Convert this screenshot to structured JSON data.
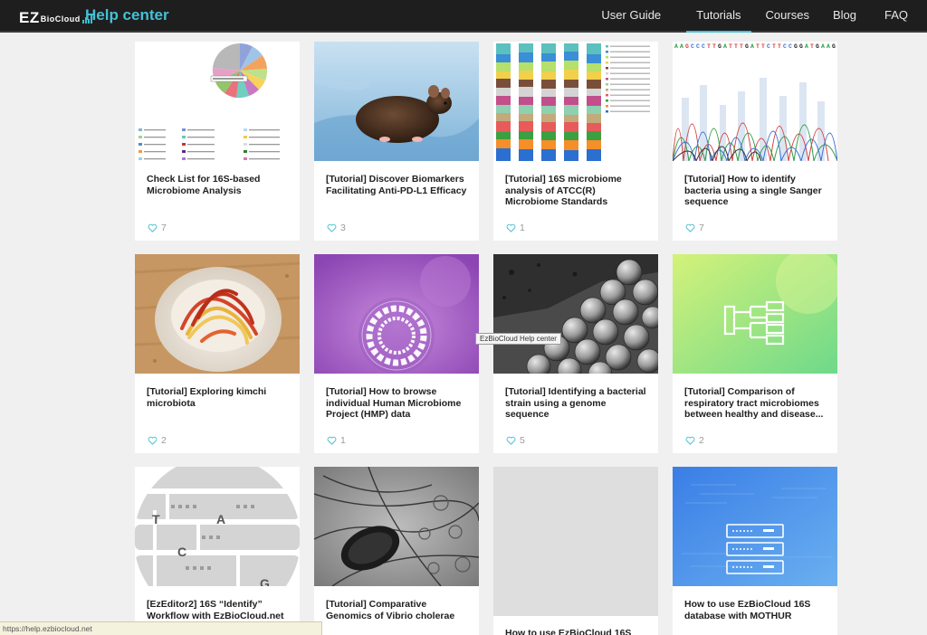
{
  "header": {
    "logo": {
      "main": "EZ",
      "sub": "BioCloud"
    },
    "title": "Help center",
    "nav": [
      {
        "label": "User Guide"
      },
      {
        "label": "Tutorials",
        "active": true
      },
      {
        "label": "Courses"
      },
      {
        "label": "Blog"
      },
      {
        "label": "FAQ"
      }
    ],
    "accent_color": "#44c1d6"
  },
  "cards": [
    {
      "title": "Check List for 16S-based Microbiome Analysis",
      "likes": "7",
      "thumbnail": "pie-chart-legend"
    },
    {
      "title": "[Tutorial] Discover Biomarkers Facilitating Anti-PD-L1 Efficacy",
      "likes": "3",
      "thumbnail": "mouse-photo"
    },
    {
      "title": "[Tutorial] 16S microbiome analysis of ATCC(R) Microbiome Standards",
      "likes": "1",
      "thumbnail": "stacked-bars"
    },
    {
      "title": "[Tutorial] How to identify bacteria using a single Sanger sequence",
      "likes": "7",
      "thumbnail": "chromatogram"
    },
    {
      "title": "[Tutorial] Exploring kimchi microbiota",
      "likes": "2",
      "thumbnail": "kimchi-photo"
    },
    {
      "title": "[Tutorial] How to browse individual Human Microbiome Project (HMP) data",
      "likes": "1",
      "thumbnail": "purple-circle-icon"
    },
    {
      "title": "[Tutorial] Identifying a bacterial strain using a genome sequence",
      "likes": "5",
      "thumbnail": "bacteria-micrograph"
    },
    {
      "title": "[Tutorial] Comparison of respiratory tract microbiomes between healthy and disease...",
      "likes": "2",
      "thumbnail": "green-tree-icon"
    },
    {
      "title": "[EzEditor2] 16S “Identify” Workflow with EzBioCloud.net",
      "likes": "",
      "thumbnail": "sequence-circle",
      "letters": [
        "T",
        "A",
        "C",
        "G"
      ]
    },
    {
      "title": "[Tutorial] Comparative Genomics of Vibrio cholerae",
      "likes": "",
      "thumbnail": "vibrio-micrograph"
    },
    {
      "title": "How to use EzBioCloud 16S",
      "likes": "",
      "thumbnail": "blank"
    },
    {
      "title": "How to use EzBioCloud 16S database with MOTHUR",
      "likes": "",
      "thumbnail": "blue-server-icon"
    }
  ],
  "tooltip": "EzBioCloud Help center",
  "status_url": "https://help.ezbiocloud.net"
}
